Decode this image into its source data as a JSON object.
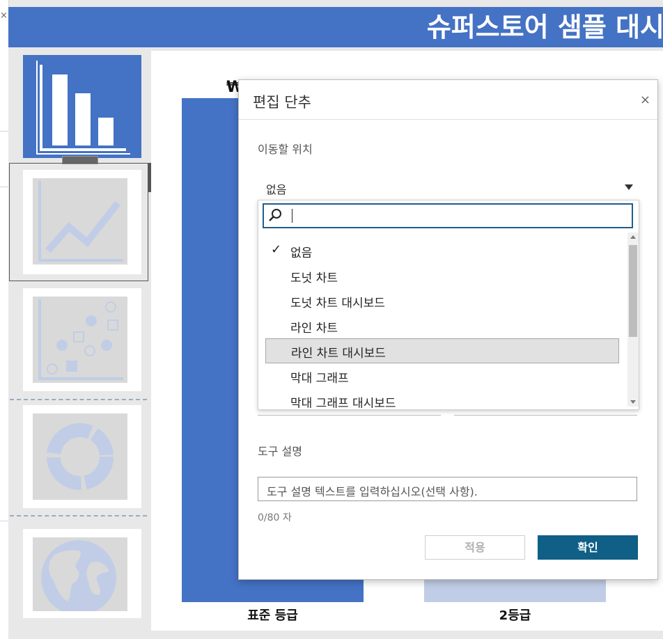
{
  "window": {
    "banner_title": "슈퍼스토어 샘플 대시",
    "left_close_glyph": "×"
  },
  "colors": {
    "accent": "#4472c4",
    "light_bar": "#c1cde6",
    "primary_button": "#0f5f86",
    "thumb_gray": "#d9d9d9"
  },
  "thumbnails": [
    {
      "name": "bar-chart-thumbnail",
      "icon": "bar-chart-icon"
    },
    {
      "name": "line-chart-thumbnail",
      "icon": "line-chart-icon"
    },
    {
      "name": "scatter-plot-thumbnail",
      "icon": "scatter-plot-icon"
    },
    {
      "name": "donut-chart-thumbnail",
      "icon": "donut-chart-icon"
    },
    {
      "name": "map-thumbnail",
      "icon": "globe-icon"
    }
  ],
  "thumb_toolbar": {
    "close_glyph": "✕",
    "more_glyph": "▾"
  },
  "canvas": {
    "partial_text": "₩",
    "categories": [
      "표준 등급",
      "2등급"
    ]
  },
  "dialog": {
    "title": "편집 단추",
    "close_glyph": "×",
    "target_label": "이동할 위치",
    "target_value": "없음",
    "search_placeholder": "",
    "options": [
      {
        "label": "없음",
        "selected": true
      },
      {
        "label": "도넛 차트",
        "selected": false
      },
      {
        "label": "도넛 차트 대시보드",
        "selected": false
      },
      {
        "label": "라인 차트",
        "selected": false
      },
      {
        "label": "라인 차트 대시보드",
        "selected": false,
        "hover": true
      },
      {
        "label": "막대 그래프",
        "selected": false
      },
      {
        "label": "막대 그래프 대시보드",
        "selected": false
      }
    ],
    "check_glyph": "✓",
    "tooltip_label": "도구 설명",
    "tooltip_placeholder": "도구 설명 텍스트를 입력하십시오(선택 사항).",
    "char_count": "0/80 자",
    "apply_label": "적용",
    "ok_label": "확인"
  }
}
